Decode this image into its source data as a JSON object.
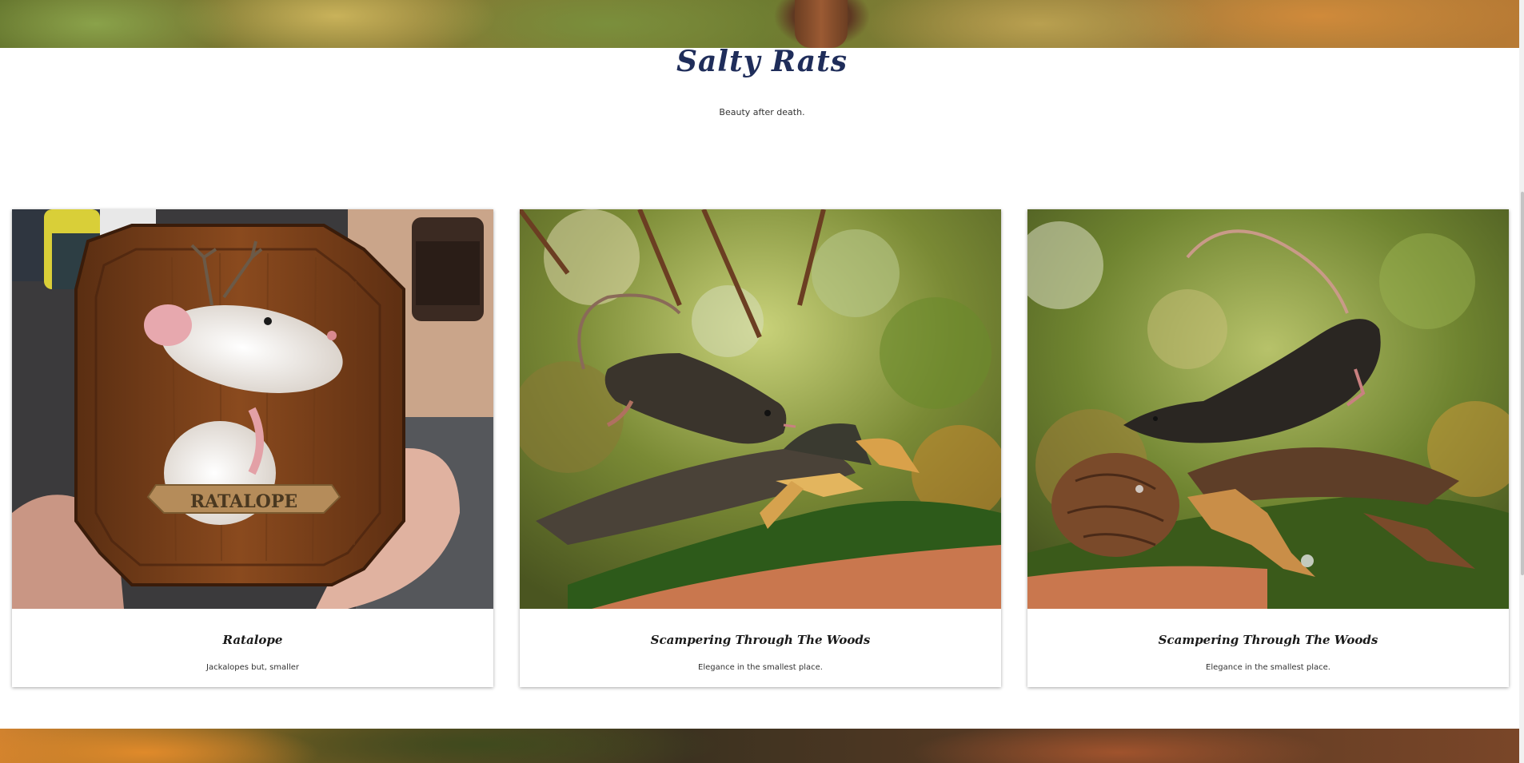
{
  "site": {
    "title": "Salty Rats",
    "tagline": "Beauty after death."
  },
  "cards": [
    {
      "title": "Ratalope",
      "description": "Jackalopes but, smaller",
      "plaque_text": "RATALOPE"
    },
    {
      "title": "Scampering Through The Woods",
      "description": "Elegance in the smallest place."
    },
    {
      "title": "Scampering Through The Woods",
      "description": "Elegance in the smallest place."
    }
  ]
}
